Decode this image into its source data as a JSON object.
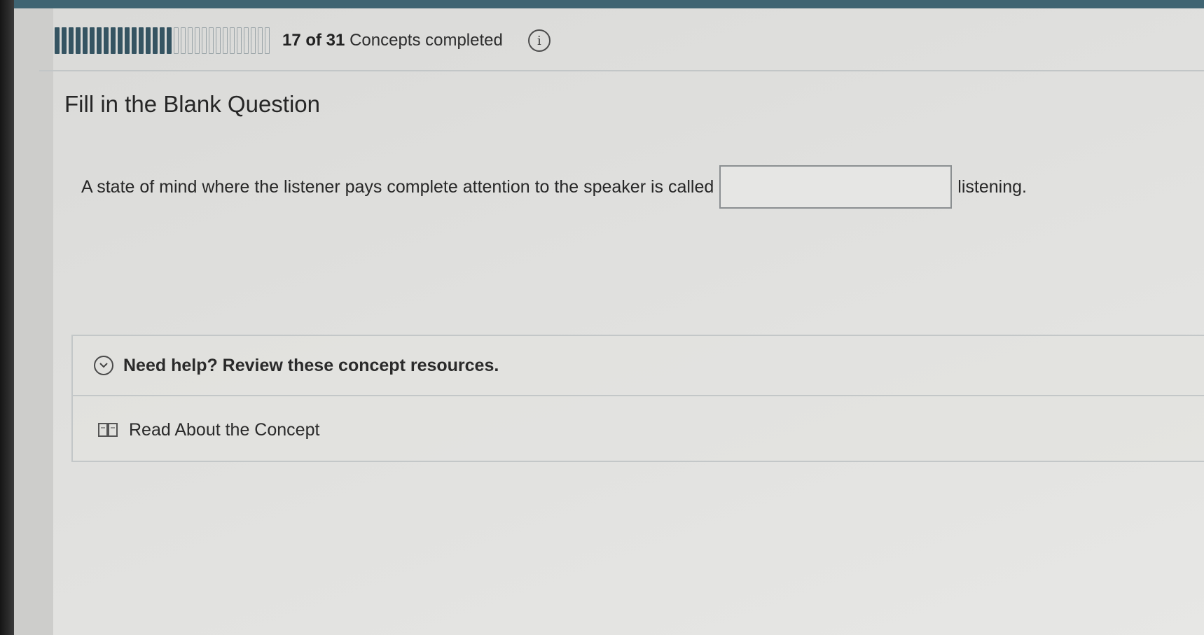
{
  "progress": {
    "completed": 17,
    "total": 31,
    "count_label": "17 of 31",
    "suffix_label": "Concepts completed",
    "done_color": "#355462",
    "info_icon": "info-circle-icon",
    "info_glyph": "i"
  },
  "question": {
    "title": "Fill in the Blank Question",
    "prompt_before": "A state of mind where the listener pays complete attention to the speaker is called",
    "answer_value": "",
    "prompt_after": "listening."
  },
  "help": {
    "toggle_label": "Need help? Review these concept resources.",
    "toggle_icon": "chevron-down-circle-icon",
    "resources": [
      {
        "label": "Read About the Concept",
        "icon": "book-icon"
      }
    ]
  }
}
